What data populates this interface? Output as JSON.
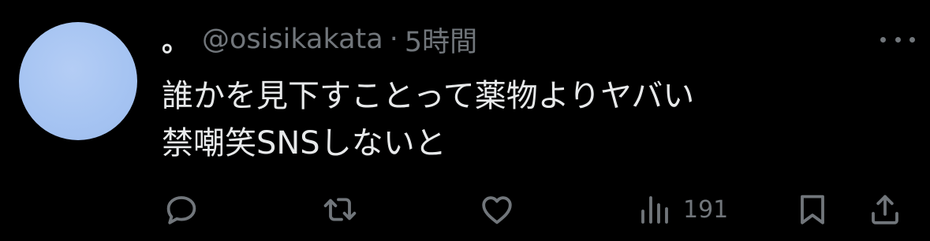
{
  "tweet": {
    "display_name": "。",
    "handle": "@osisikakata",
    "separator": "·",
    "time": "5時間",
    "text_lines": [
      "誰かを見下すことって薬物よりヤバい",
      "禁嘲笑SNSしないと"
    ],
    "avatar_color": "#a8c6f2"
  },
  "actions": {
    "reply_icon": "reply-bubble-icon",
    "retweet_icon": "retweet-arrows-icon",
    "like_icon": "heart-icon",
    "views_icon": "bar-chart-icon",
    "views_count": "191",
    "bookmark_icon": "bookmark-icon",
    "share_icon": "share-upload-icon"
  },
  "colors": {
    "background": "#000000",
    "primary_text": "#e7e9ea",
    "secondary_text": "#71767b"
  }
}
